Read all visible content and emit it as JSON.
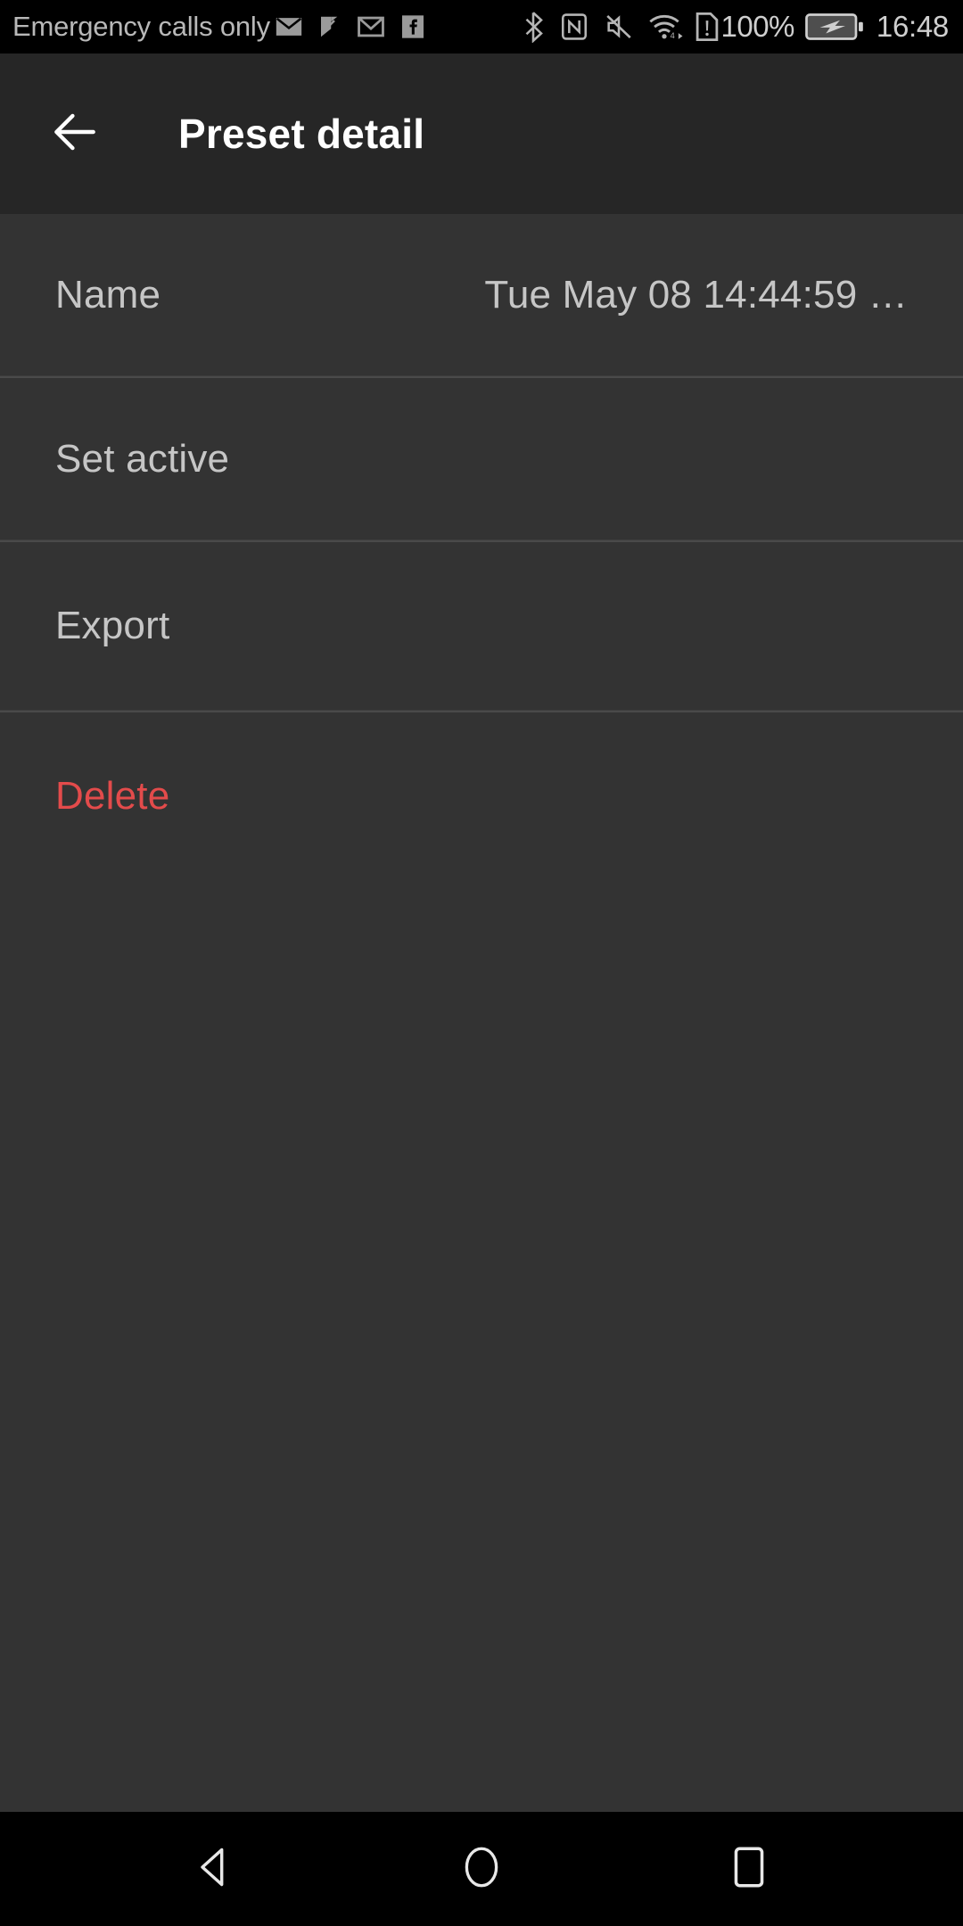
{
  "status_bar": {
    "carrier": "Emergency calls only",
    "left_icons": [
      {
        "name": "email-icon"
      },
      {
        "name": "mail-check-icon"
      },
      {
        "name": "gmail-icon"
      },
      {
        "name": "facebook-icon"
      }
    ],
    "right_icons": [
      {
        "name": "bluetooth-icon"
      },
      {
        "name": "nfc-icon"
      },
      {
        "name": "volume-mute-icon"
      },
      {
        "name": "wifi-icon"
      },
      {
        "name": "sim-alert-icon"
      }
    ],
    "battery_percent": "100%",
    "battery_icon": "battery-charging-icon",
    "clock": "16:48"
  },
  "toolbar": {
    "back_icon": "arrow-back-icon",
    "title": "Preset detail"
  },
  "settings": {
    "rows": [
      {
        "name": "name",
        "label": "Name",
        "value": "Tue May 08 14:44:59 …",
        "danger": false
      },
      {
        "name": "set-active",
        "label": "Set active",
        "value": "",
        "danger": false
      },
      {
        "name": "export",
        "label": "Export",
        "value": "",
        "danger": false
      },
      {
        "name": "delete",
        "label": "Delete",
        "value": "",
        "danger": true
      }
    ]
  },
  "nav_bar": {
    "back_label": "back-triangle-icon",
    "home_label": "home-circle-icon",
    "recents_label": "recents-square-icon"
  },
  "colors": {
    "status_bar_bg": "#000000",
    "toolbar_bg": "#262626",
    "content_bg": "#333333",
    "divider": "#4a4a4a",
    "primary_text": "#ffffff",
    "secondary_text": "#c6c6c6",
    "danger_text": "#e34b4b",
    "nav_bar_bg": "#000000"
  }
}
